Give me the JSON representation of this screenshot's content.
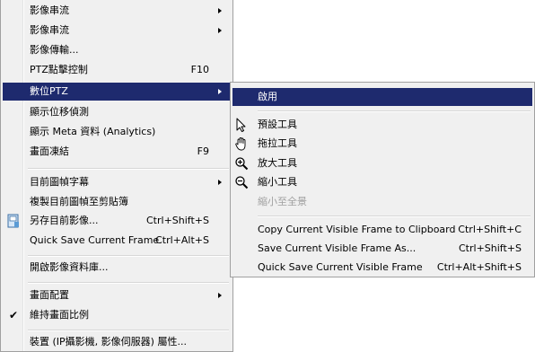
{
  "main_menu": {
    "items": [
      {
        "label": "影像串流",
        "has_submenu": true
      },
      {
        "label": "影像串流",
        "has_submenu": true
      },
      {
        "label": "影像傳輸..."
      },
      {
        "label": "PTZ點擊控制",
        "shortcut": "F10"
      },
      {
        "label": "數位PTZ",
        "has_submenu": true,
        "selected": true
      },
      {
        "label": "顯示位移偵測"
      },
      {
        "label": "顯示 Meta 資料 (Analytics)"
      },
      {
        "label": "畫面凍結",
        "shortcut": "F9"
      },
      {
        "label": "目前圖幀字幕",
        "has_submenu": true
      },
      {
        "label": "複製目前圖幀至剪貼簿"
      },
      {
        "label": "另存目前影像...",
        "shortcut": "Ctrl+Shift+S",
        "icon": "save-icon"
      },
      {
        "label": "Quick Save Current Frame",
        "shortcut": "Ctrl+Alt+S"
      },
      {
        "label": "開啟影像資料庫..."
      },
      {
        "label": "畫面配置",
        "has_submenu": true
      },
      {
        "label": "維持畫面比例",
        "checked": true
      },
      {
        "label": "裝置 (IP攝影機, 影像伺服器) 屬性..."
      }
    ]
  },
  "sub_menu": {
    "items": [
      {
        "label": "啟用",
        "selected": true
      },
      {
        "label": "預設工具",
        "icon": "pointer-arrow-icon"
      },
      {
        "label": "拖拉工具",
        "icon": "hand-grab-icon"
      },
      {
        "label": "放大工具",
        "icon": "zoom-in-icon"
      },
      {
        "label": "縮小工具",
        "icon": "zoom-out-icon"
      },
      {
        "label": "縮小至全景",
        "disabled": true
      },
      {
        "label": "Copy Current Visible Frame to Clipboard",
        "shortcut": "Ctrl+Shift+C"
      },
      {
        "label": "Save Current Visible Frame As...",
        "shortcut": "Ctrl+Shift+S"
      },
      {
        "label": "Quick Save Current Visible Frame",
        "shortcut": "Ctrl+Alt+Shift+S"
      }
    ]
  },
  "colors": {
    "selection": "#1e2a6e",
    "menu_bg": "#f0f0f0",
    "disabled": "#a0a0a0"
  }
}
